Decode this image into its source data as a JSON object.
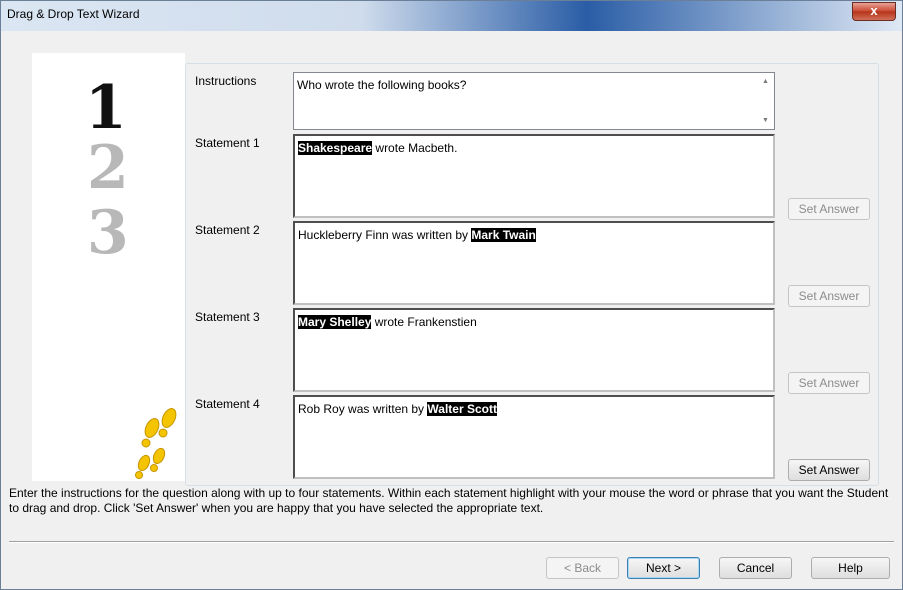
{
  "window": {
    "title": "Drag & Drop Text Wizard",
    "close_label": "x"
  },
  "graphic": {
    "numbers": [
      "1",
      "2",
      "3"
    ]
  },
  "form": {
    "instructions_label": "Instructions",
    "instructions_value": "Who wrote the following books?",
    "statements": [
      {
        "label": "Statement 1",
        "pre": "",
        "answer": "Shakespeare",
        "post": " wrote Macbeth."
      },
      {
        "label": "Statement 2",
        "pre": "Huckleberry Finn was written by ",
        "answer": "Mark Twain",
        "post": ""
      },
      {
        "label": "Statement 3",
        "pre": "",
        "answer": "Mary Shelley",
        "post": " wrote Frankenstien"
      },
      {
        "label": "Statement 4",
        "pre": "Rob Roy was written by ",
        "answer": "Walter Scott",
        "post": ""
      }
    ],
    "set_answer_label": "Set Answer"
  },
  "help_text": "Enter the instructions for the question along with up to four statements. Within each statement highlight with your mouse the word or phrase that you want the Student to drag and drop. Click 'Set Answer' when you are happy that you have selected the appropriate text.",
  "footer": {
    "back_label": "< Back",
    "next_label": "Next >",
    "cancel_label": "Cancel",
    "help_label": "Help"
  },
  "colors": {
    "highlight_bg": "#000000",
    "highlight_fg": "#ffffff",
    "footprint": "#f4c400"
  },
  "icons": {
    "footsteps": "footsteps-icon",
    "scroll_up": "scroll-up-arrow-icon",
    "scroll_down": "scroll-down-arrow-icon"
  }
}
